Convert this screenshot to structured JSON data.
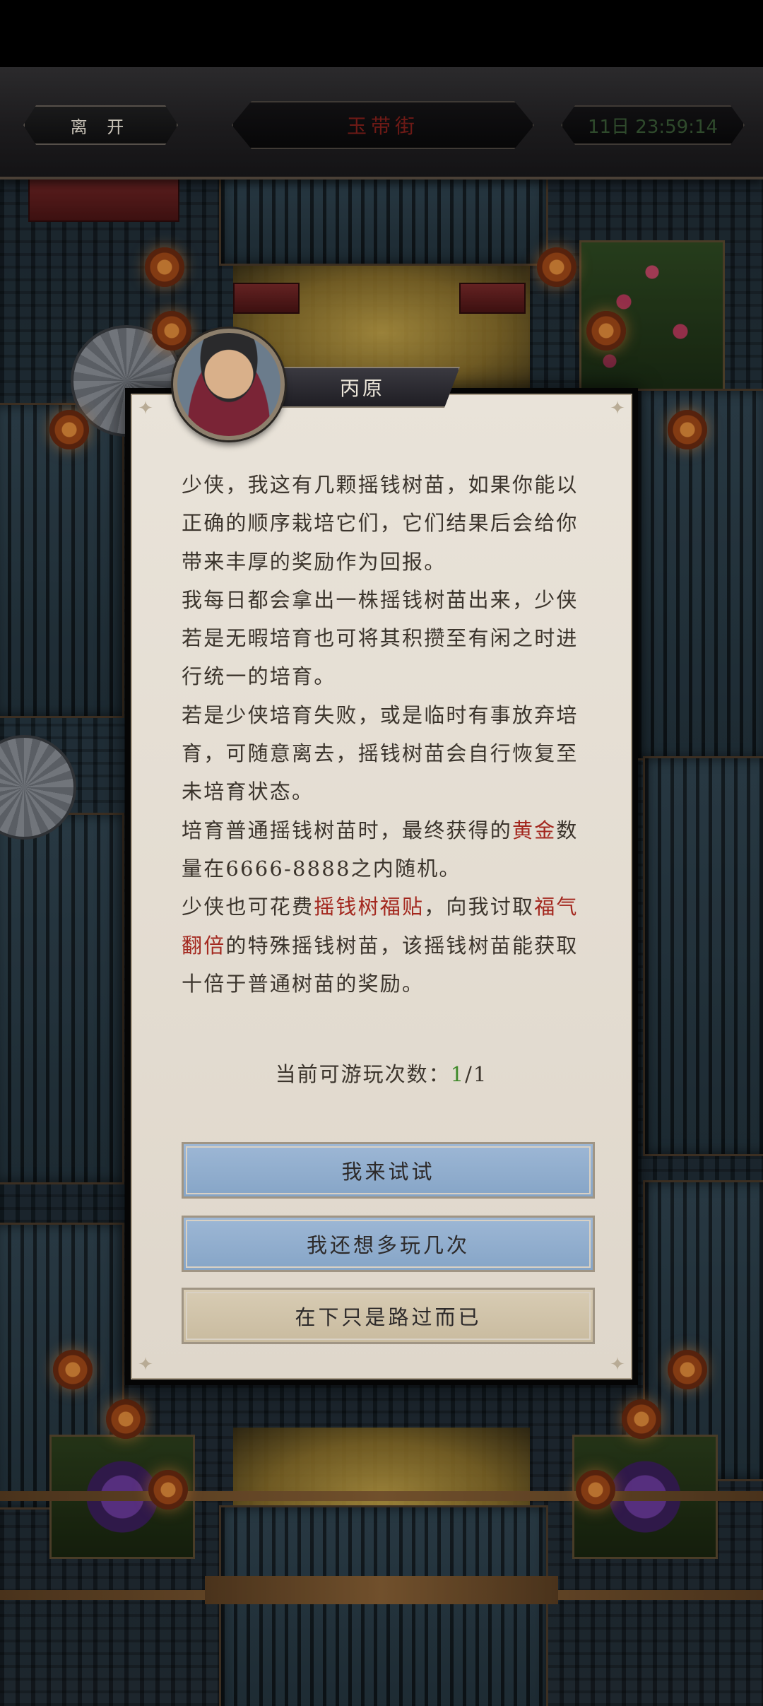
{
  "header": {
    "leave_label": "离 开",
    "location_title": "玉带街",
    "time_text": "11日 23:59:14"
  },
  "npc": {
    "name": "丙原",
    "avatar": "portrait"
  },
  "dialog": {
    "paragraphs": [
      [
        "少侠，我这有几颗摇钱树苗，如果你能以正确的顺序栽培它们，它们结果后会给你带来丰厚的奖励作为回报。"
      ],
      [
        "我每日都会拿出一株摇钱树苗出来，少侠若是无暇培育也可将其积攒至有闲之时进行统一的培育。"
      ],
      [
        "若是少侠培育失败，或是临时有事放弃培育，可随意离去，摇钱树苗会自行恢复至未培育状态。"
      ],
      [
        "培育普通摇钱树苗时，最终获得的",
        "黄金",
        "数量在6666-8888之内随机。"
      ],
      [
        "少侠也可花费",
        "摇钱树福贴",
        "，向我讨取",
        "福气翻倍",
        "的特殊摇钱树苗，该摇钱树苗能获取十倍于普通树苗的奖励。"
      ]
    ],
    "plays_label": "当前可游玩次数：",
    "plays_current": "1",
    "plays_total": "/1"
  },
  "buttons": {
    "try": "我来试试",
    "play_more": "我还想多玩几次",
    "pass_by": "在下只是路过而已"
  },
  "colors": {
    "highlight_red": "#a3271e",
    "count_green": "#3f8a2a",
    "button_blue": "#8ea9c9",
    "button_tan": "#cfc2a8",
    "panel": "#e6e0d6"
  }
}
